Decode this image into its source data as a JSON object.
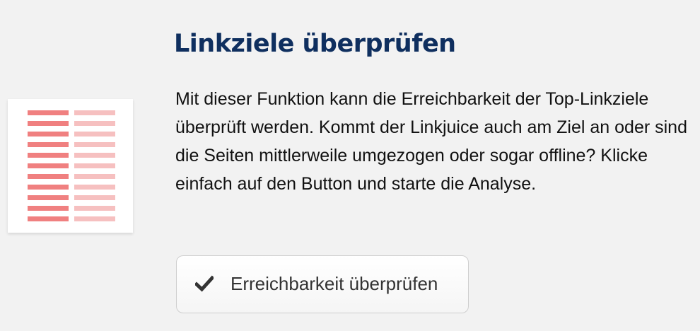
{
  "title": "Linkziele überprüfen",
  "description": "Mit dieser Funktion kann die Erreichbarkeit der Top-Linkziele überprüft werden. Kommt der Linkjuice auch am Ziel an oder sind die Seiten mittlerweile umgezogen oder sogar offline? Klicke einfach auf den Button und starte die Analyse.",
  "button": {
    "label": "Erreichbarkeit überprüfen",
    "icon": "check-icon"
  },
  "illustration": {
    "icon": "link-list-illustration",
    "row_count": 11,
    "colors": {
      "primary": "#f08080",
      "secondary": "#f6c0c0"
    }
  },
  "colors": {
    "title": "#0f2f5f",
    "background": "#f2f2f2"
  }
}
